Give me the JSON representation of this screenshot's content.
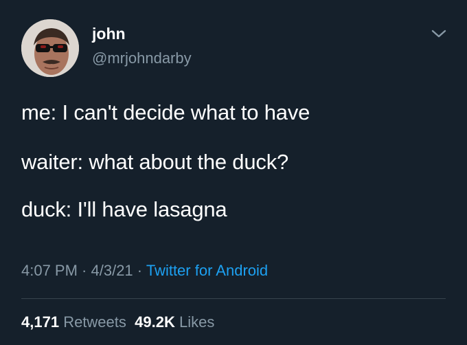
{
  "author": {
    "name": "john",
    "handle": "@mrjohndarby"
  },
  "icons": {
    "more": "chevron-down-icon",
    "avatar": "profile-photo"
  },
  "tweet": {
    "lines": [
      "me: I can't decide what to have",
      "waiter: what about the duck?",
      "duck: I'll have lasagna"
    ]
  },
  "meta": {
    "time": "4:07 PM",
    "separator": " · ",
    "date": "4/3/21",
    "source": "Twitter for Android"
  },
  "stats": {
    "retweets_count": "4,171",
    "retweets_label": "Retweets",
    "likes_count": "49.2K",
    "likes_label": "Likes"
  },
  "colors": {
    "background": "#15202b",
    "text": "#ffffff",
    "secondary": "#8899a6",
    "link": "#1da1f2"
  }
}
